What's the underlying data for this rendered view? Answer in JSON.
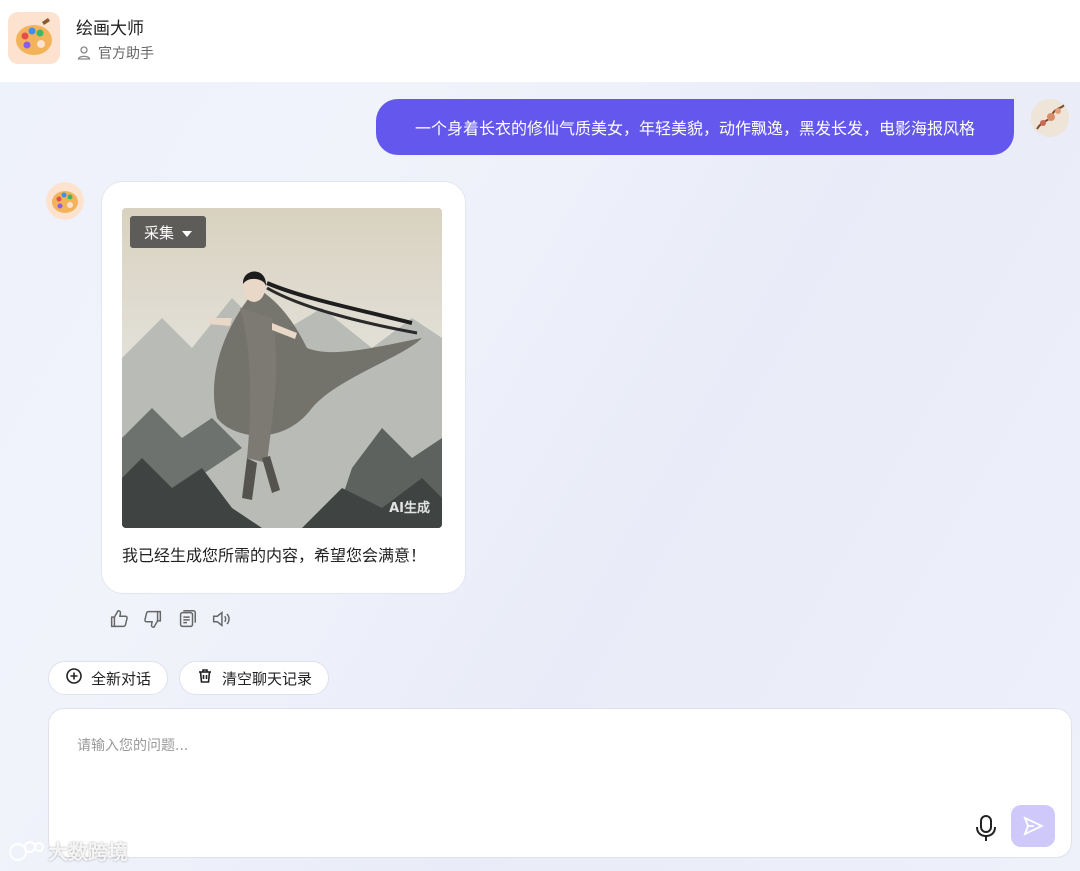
{
  "header": {
    "title": "绘画大师",
    "subtitle": "官方助手"
  },
  "conversation": {
    "user_message": "一个身着长衣的修仙气质美女，年轻美貌，动作飘逸，黑发长发，电影海报风格",
    "bot_reply": {
      "collect_label": "采集",
      "ai_badge": "AI生成",
      "text": "我已经生成您所需的内容，希望您会满意！"
    }
  },
  "actions": {
    "new_chat": "全新对话",
    "clear_history": "清空聊天记录"
  },
  "input": {
    "placeholder": "请输入您的问题..."
  },
  "watermark": "大数跨境",
  "colors": {
    "accent": "#6457ee",
    "send_button": "#cec8fb"
  }
}
